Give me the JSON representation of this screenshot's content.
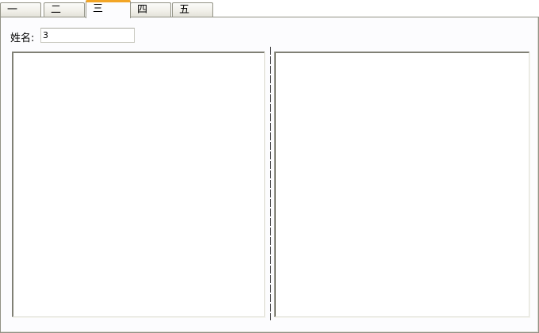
{
  "tabs": [
    {
      "label": "一"
    },
    {
      "label": "二"
    },
    {
      "label": "三",
      "active": true
    },
    {
      "label": "四"
    },
    {
      "label": "五"
    }
  ],
  "form": {
    "name_label": "姓名:",
    "name_value": "3"
  },
  "colors": {
    "active_tab_accent": "#f2a526",
    "panel_background": "#fcfcfe",
    "border": "#929285"
  }
}
